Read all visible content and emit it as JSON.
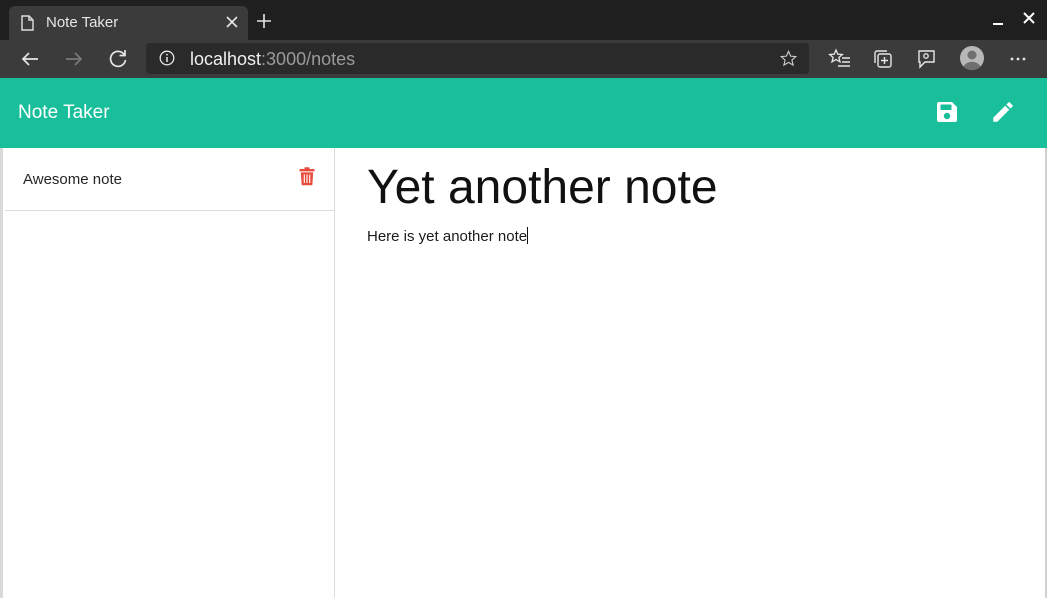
{
  "browser": {
    "tab_title": "Note Taker",
    "url_host": "localhost",
    "url_rest": ":3000/notes",
    "icons": [
      "page-icon",
      "close-icon",
      "plus-icon",
      "minimize-icon",
      "back-icon",
      "forward-icon",
      "refresh-icon",
      "info-icon",
      "star-icon",
      "favorites-icon",
      "collections-icon",
      "feedback-icon",
      "profile-icon",
      "more-icon"
    ]
  },
  "app": {
    "title": "Note Taker",
    "accent_color": "#19be9b",
    "delete_color": "#e74c3c",
    "header_icons": [
      "save-icon",
      "pencil-icon"
    ]
  },
  "notes": [
    {
      "title": "Awesome note"
    }
  ],
  "active_note": {
    "title": "Yet another note",
    "body": "Here is yet another note"
  }
}
